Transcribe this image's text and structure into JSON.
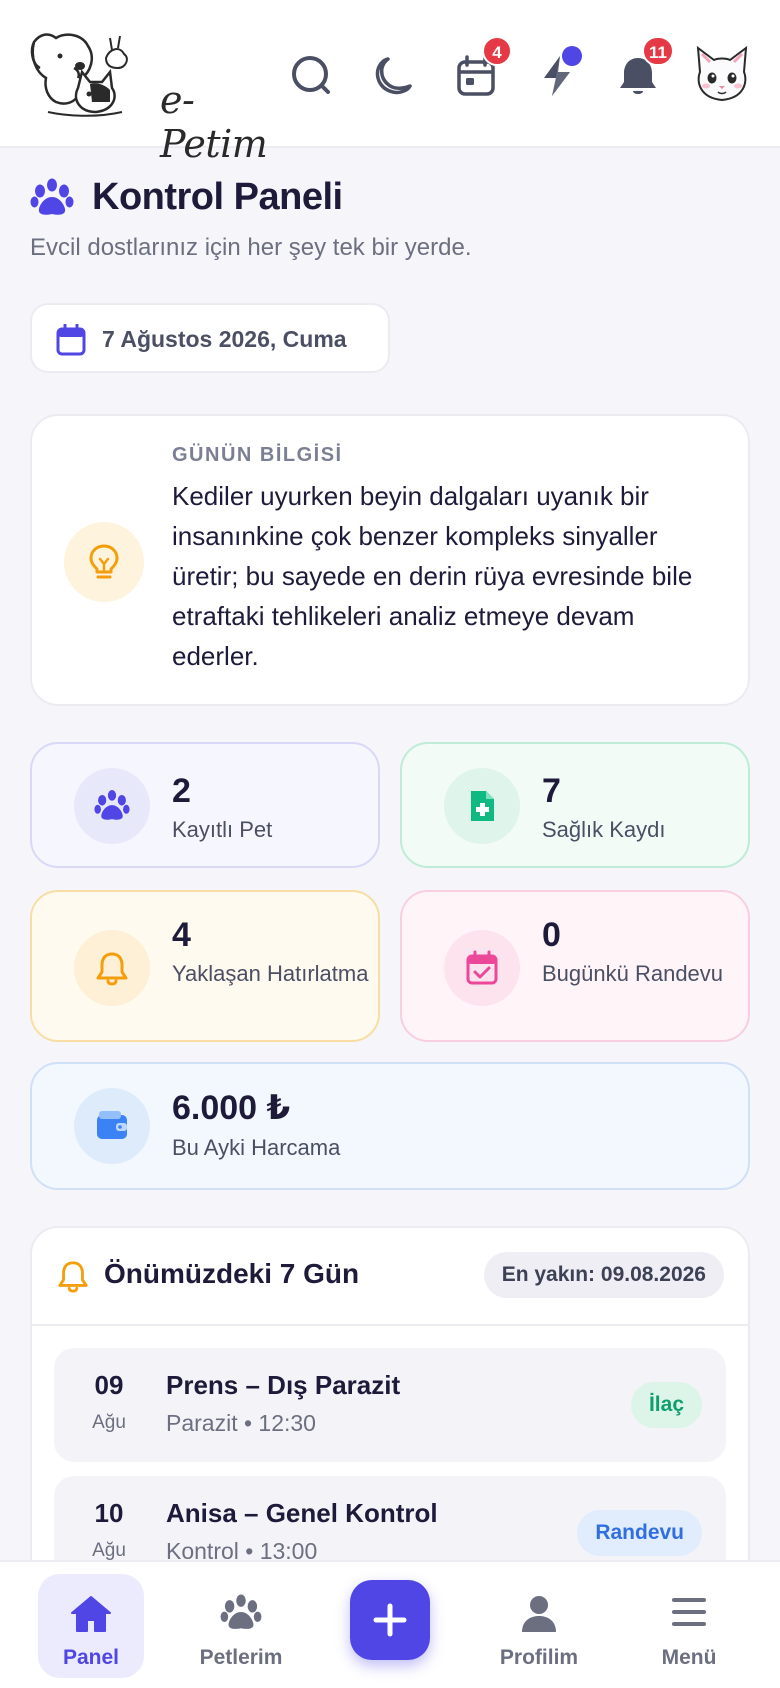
{
  "header": {
    "logo_text": "e-Petim",
    "calendar_badge": "4",
    "notifications_badge": "11"
  },
  "page": {
    "title": "Kontrol Paneli",
    "subtitle": "Evcil dostlarınız için her şey tek bir yerde.",
    "date": "7 Ağustos 2026, Cuma"
  },
  "tip": {
    "label": "GÜNÜN BİLGİSİ",
    "text": "Kediler uyurken beyin dalgaları uyanık bir insanınkine çok benzer kompleks sinyaller üretir; bu sayede en derin rüya evresinde bile etraftaki tehlikeleri analiz etmeye devam ederler."
  },
  "stats": {
    "pets": {
      "value": "2",
      "label": "Kayıtlı Pet"
    },
    "health": {
      "value": "7",
      "label": "Sağlık Kaydı"
    },
    "reminders": {
      "value": "4",
      "label": "Yaklaşan Hatırlatma"
    },
    "appointments": {
      "value": "0",
      "label": "Bugünkü Randevu"
    },
    "spending": {
      "value": "6.000 ₺",
      "label": "Bu Ayki Harcama"
    }
  },
  "upcoming": {
    "title": "Önümüzdeki 7 Gün",
    "nearest": "En yakın: 09.08.2026",
    "events": [
      {
        "day": "09",
        "month": "Ağu",
        "title": "Prens – Dış Parazit",
        "sub": "Parazit • 12:30",
        "tag": "İlaç"
      },
      {
        "day": "10",
        "month": "Ağu",
        "title": "Anisa – Genel Kontrol",
        "sub": "Kontrol • 13:00",
        "tag": "Randevu"
      }
    ]
  },
  "nav": {
    "panel": "Panel",
    "pets": "Petlerim",
    "profile": "Profilim",
    "menu": "Menü"
  },
  "colors": {
    "accent": "#4f46e5",
    "badge_red": "#e53945",
    "green": "#10b981",
    "amber": "#f59e0b",
    "pink": "#ec4899",
    "blue": "#3b82f6"
  }
}
